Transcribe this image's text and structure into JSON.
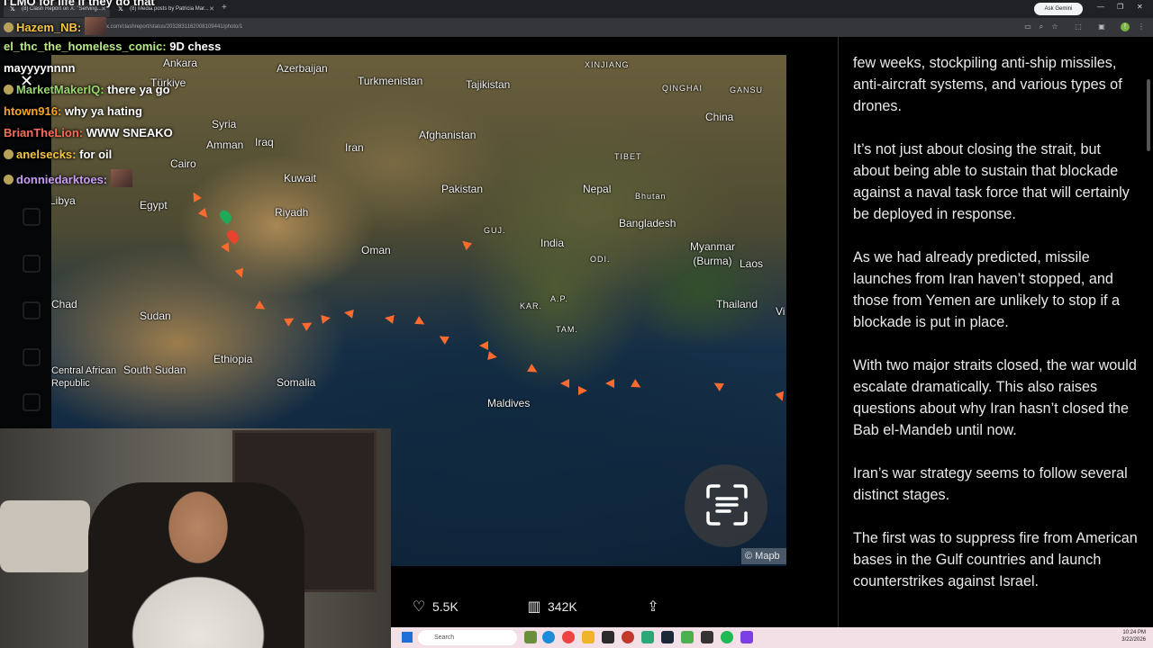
{
  "browser": {
    "tabs": [
      {
        "title": "(8) Clash Report on X: \"Serving..."
      },
      {
        "title": "(8) Media posts by Patricia Mar..."
      }
    ],
    "url": "x.com/clashreport/status/2032831162008109441/photo/1",
    "gemini_label": "Ask Gemini"
  },
  "stream_title": "I'LMO for life if they do that",
  "chat": [
    {
      "user": "Hazem_NB:",
      "msg": "",
      "color": "#f5c542"
    },
    {
      "user": "el_thc_the_homeless_comic:",
      "msg": "9D chess",
      "color": "#b8e986"
    },
    {
      "user": "",
      "msg": "mayyyynnnn",
      "color": "#ffffff"
    },
    {
      "user": "MarketMakerIQ:",
      "msg": "there ya go",
      "color": "#9ad66b"
    },
    {
      "user": "htown916:",
      "msg": "why ya hating",
      "color": "#f5a623"
    },
    {
      "user": "BrianTheLion:",
      "msg": "WWW SNEAKO",
      "color": "#ff6b5b"
    },
    {
      "user": "anelsecks:",
      "msg": "for oil",
      "color": "#f5c542"
    },
    {
      "user": "donniedarktoes:",
      "msg": "",
      "color": "#c89df5"
    }
  ],
  "map": {
    "labels": [
      "Ankara",
      "Azerbaijan",
      "Türkiye",
      "Turkmenistan",
      "Tajikistan",
      "XINJIANG",
      "GANSU",
      "QINGHAI",
      "China",
      "Syria",
      "Amman",
      "Iraq",
      "Iran",
      "Afghanistan",
      "TIBET",
      "Cairo",
      "Kuwait",
      "Pakistan",
      "Nepal",
      "Bhutan",
      "Egypt",
      "Riyadh",
      "Bangladesh",
      "Libya",
      "GUJ.",
      "India",
      "Oman",
      "Myanmar (Burma)",
      "Laos",
      "Chad",
      "Sudan",
      "KAR.",
      "A.P.",
      "Thailand",
      "Ethiopia",
      "Central African Republic",
      "South Sudan",
      "Somalia",
      "Maldives",
      "ODI.",
      "TAM.",
      "Vi"
    ],
    "attribution": "© Mapb"
  },
  "tweet": {
    "likes": "5.5K",
    "views": "342K"
  },
  "article": {
    "paragraphs": [
      "few weeks, stockpiling anti-ship missiles, anti-aircraft systems, and various types of drones.",
      "It’s not just about closing the strait, but about being able to sustain that blockade against a naval task force that will certainly be deployed in response.",
      "As we had already predicted, missile launches from Iran haven’t stopped, and those from Yemen are unlikely to stop if a blockade is put in place.",
      "With two major straits closed, the war would escalate dramatically. This also raises questions about why Iran hasn’t closed the Bab el-Mandeb until now.",
      "Iran’s war strategy seems to follow several distinct stages.",
      "The first was to suppress fire from American bases in the Gulf countries and launch counterstrikes against Israel."
    ]
  },
  "taskbar": {
    "search_placeholder": "Search",
    "time": "10:24 PM",
    "date": "3/22/2026"
  },
  "colors": {
    "accent": "#1d9bf0",
    "ship": "#ff6a2e",
    "taskbar": "#f3dfe6"
  }
}
